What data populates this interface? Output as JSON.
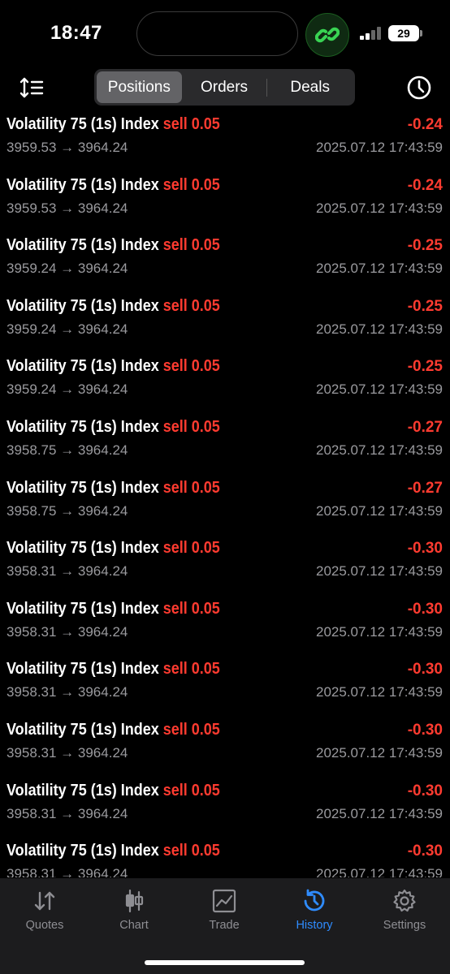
{
  "status": {
    "time": "18:47",
    "battery": "29"
  },
  "toolbar": {
    "tabs": [
      {
        "label": "Positions",
        "active": true
      },
      {
        "label": "Orders",
        "active": false
      },
      {
        "label": "Deals",
        "active": false
      }
    ]
  },
  "rows": [
    {
      "symbol": "Volatility 75 (1s) Index",
      "side": "sell 0.05",
      "profit": "-0.24",
      "prices": "3959.53 → 3964.24",
      "date": "2025.07.12 17:43:59"
    },
    {
      "symbol": "Volatility 75 (1s) Index",
      "side": "sell 0.05",
      "profit": "-0.24",
      "prices": "3959.53 → 3964.24",
      "date": "2025.07.12 17:43:59"
    },
    {
      "symbol": "Volatility 75 (1s) Index",
      "side": "sell 0.05",
      "profit": "-0.25",
      "prices": "3959.24 → 3964.24",
      "date": "2025.07.12 17:43:59"
    },
    {
      "symbol": "Volatility 75 (1s) Index",
      "side": "sell 0.05",
      "profit": "-0.25",
      "prices": "3959.24 → 3964.24",
      "date": "2025.07.12 17:43:59"
    },
    {
      "symbol": "Volatility 75 (1s) Index",
      "side": "sell 0.05",
      "profit": "-0.25",
      "prices": "3959.24 → 3964.24",
      "date": "2025.07.12 17:43:59"
    },
    {
      "symbol": "Volatility 75 (1s) Index",
      "side": "sell 0.05",
      "profit": "-0.27",
      "prices": "3958.75 → 3964.24",
      "date": "2025.07.12 17:43:59"
    },
    {
      "symbol": "Volatility 75 (1s) Index",
      "side": "sell 0.05",
      "profit": "-0.27",
      "prices": "3958.75 → 3964.24",
      "date": "2025.07.12 17:43:59"
    },
    {
      "symbol": "Volatility 75 (1s) Index",
      "side": "sell 0.05",
      "profit": "-0.30",
      "prices": "3958.31 → 3964.24",
      "date": "2025.07.12 17:43:59"
    },
    {
      "symbol": "Volatility 75 (1s) Index",
      "side": "sell 0.05",
      "profit": "-0.30",
      "prices": "3958.31 → 3964.24",
      "date": "2025.07.12 17:43:59"
    },
    {
      "symbol": "Volatility 75 (1s) Index",
      "side": "sell 0.05",
      "profit": "-0.30",
      "prices": "3958.31 → 3964.24",
      "date": "2025.07.12 17:43:59"
    },
    {
      "symbol": "Volatility 75 (1s) Index",
      "side": "sell 0.05",
      "profit": "-0.30",
      "prices": "3958.31 → 3964.24",
      "date": "2025.07.12 17:43:59"
    },
    {
      "symbol": "Volatility 75 (1s) Index",
      "side": "sell 0.05",
      "profit": "-0.30",
      "prices": "3958.31 → 3964.24",
      "date": "2025.07.12 17:43:59"
    },
    {
      "symbol": "Volatility 75 (1s) Index",
      "side": "sell 0.05",
      "profit": "-0.30",
      "prices": "3958.31 → 3964.24",
      "date": "2025.07.12 17:43:59"
    }
  ],
  "tabbar": {
    "items": [
      {
        "label": "Quotes",
        "icon": "quotes-icon",
        "active": false
      },
      {
        "label": "Chart",
        "icon": "chart-icon",
        "active": false
      },
      {
        "label": "Trade",
        "icon": "trade-icon",
        "active": false
      },
      {
        "label": "History",
        "icon": "history-icon",
        "active": true
      },
      {
        "label": "Settings",
        "icon": "settings-icon",
        "active": false
      }
    ]
  },
  "colors": {
    "loss": "#ff3b30",
    "accent": "#2f8cff",
    "muted": "#9a9a9e"
  }
}
